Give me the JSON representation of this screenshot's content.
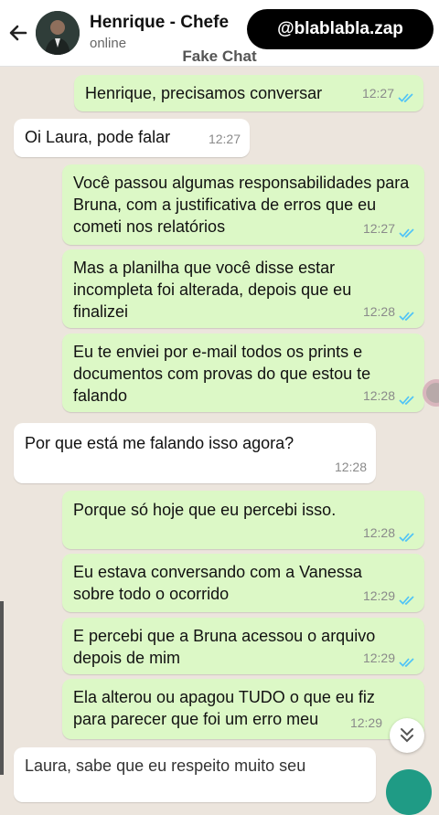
{
  "header": {
    "contact_name": "Henrique - Chefe",
    "status": "online",
    "back_icon": "arrow-left-icon",
    "watermark": "@blablabla.zap"
  },
  "caption": "Fake Chat",
  "messages": [
    {
      "dir": "out",
      "text": "Henrique, precisamos conversar",
      "time": "12:27",
      "ticks": "read"
    },
    {
      "dir": "in",
      "text": "Oi Laura, pode falar",
      "time": "12:27"
    },
    {
      "dir": "out",
      "text": "Você passou algumas responsabilidades para Bruna, com a justificativa de erros que eu cometi nos relatórios",
      "time": "12:27",
      "ticks": "read"
    },
    {
      "dir": "out",
      "text": "Mas a planilha que você disse estar incompleta foi alterada, depois que eu finalizei",
      "time": "12:28",
      "ticks": "read"
    },
    {
      "dir": "out",
      "text": "Eu te enviei por e-mail todos os prints e documentos com provas do que estou te falando",
      "time": "12:28",
      "ticks": "read"
    },
    {
      "dir": "in",
      "text": "Por que está me falando isso agora?",
      "time": "12:28"
    },
    {
      "dir": "out",
      "text": "Porque só hoje que eu percebi isso.",
      "time": "12:28",
      "ticks": "read"
    },
    {
      "dir": "out",
      "text": "Eu estava conversando com a Vanessa sobre todo o ocorrido",
      "time": "12:29",
      "ticks": "read"
    },
    {
      "dir": "out",
      "text": "E percebi que a Bruna acessou o arquivo depois de mim",
      "time": "12:29",
      "ticks": "read"
    },
    {
      "dir": "out",
      "text": "Ela alterou ou apagou TUDO o que eu fiz para parecer que foi um erro meu",
      "time": "12:29",
      "ticks": "read"
    },
    {
      "dir": "in",
      "text": "Laura, sabe que eu respeito muito seu",
      "time": ""
    }
  ],
  "colors": {
    "outgoing_bubble": "#dcf8c6",
    "incoming_bubble": "#ffffff",
    "chat_background": "#ece5dd",
    "read_ticks": "#4fc3f7"
  },
  "scroll_down_icon": "double-chevron-down-icon"
}
